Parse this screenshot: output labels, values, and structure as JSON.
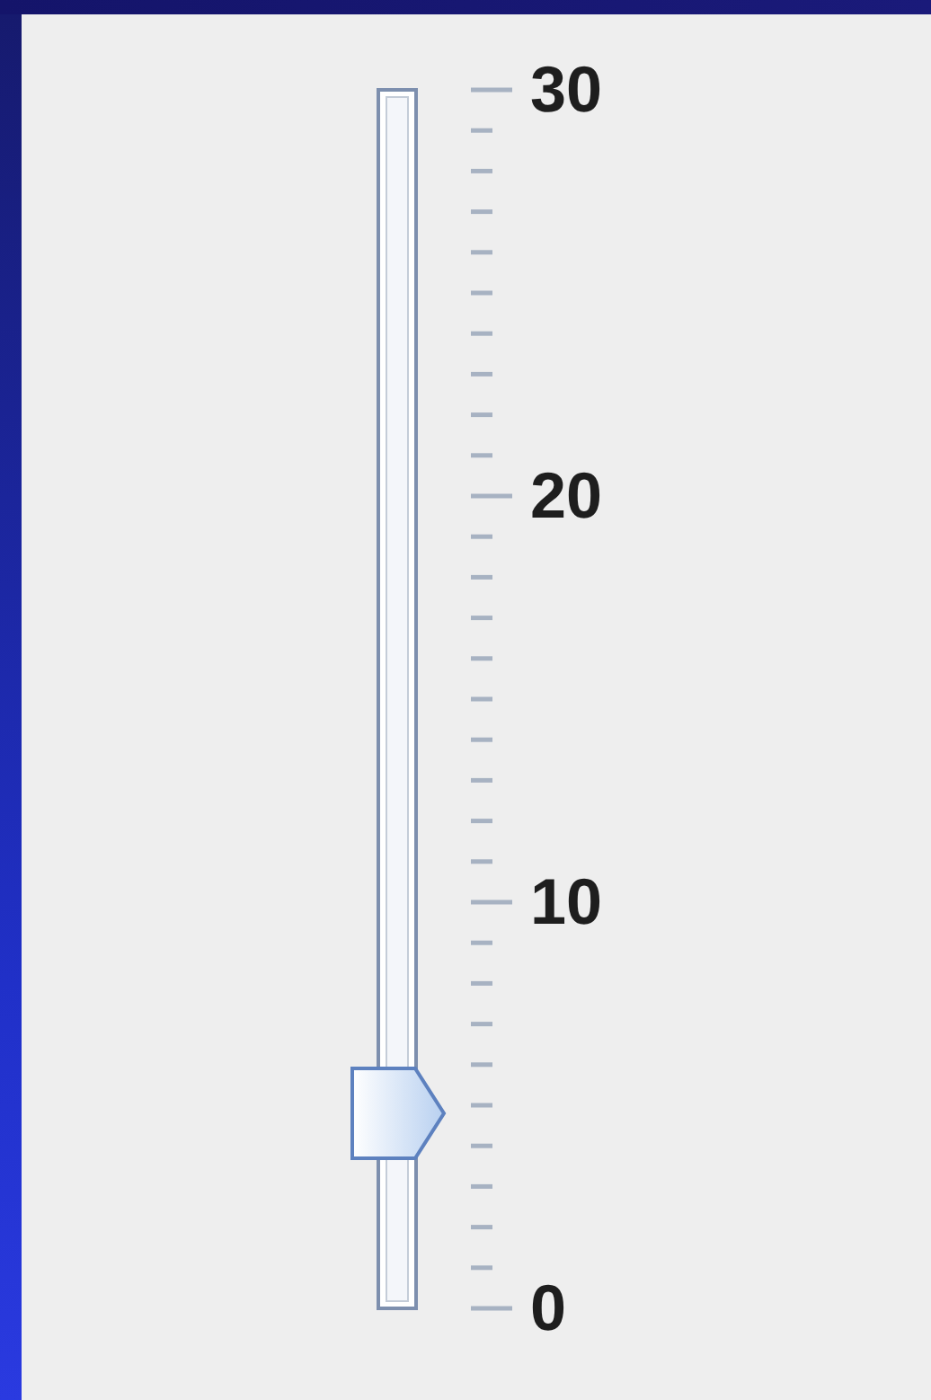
{
  "slider": {
    "level": 0.16,
    "labels": [
      "30",
      "20",
      "10",
      "0"
    ]
  }
}
